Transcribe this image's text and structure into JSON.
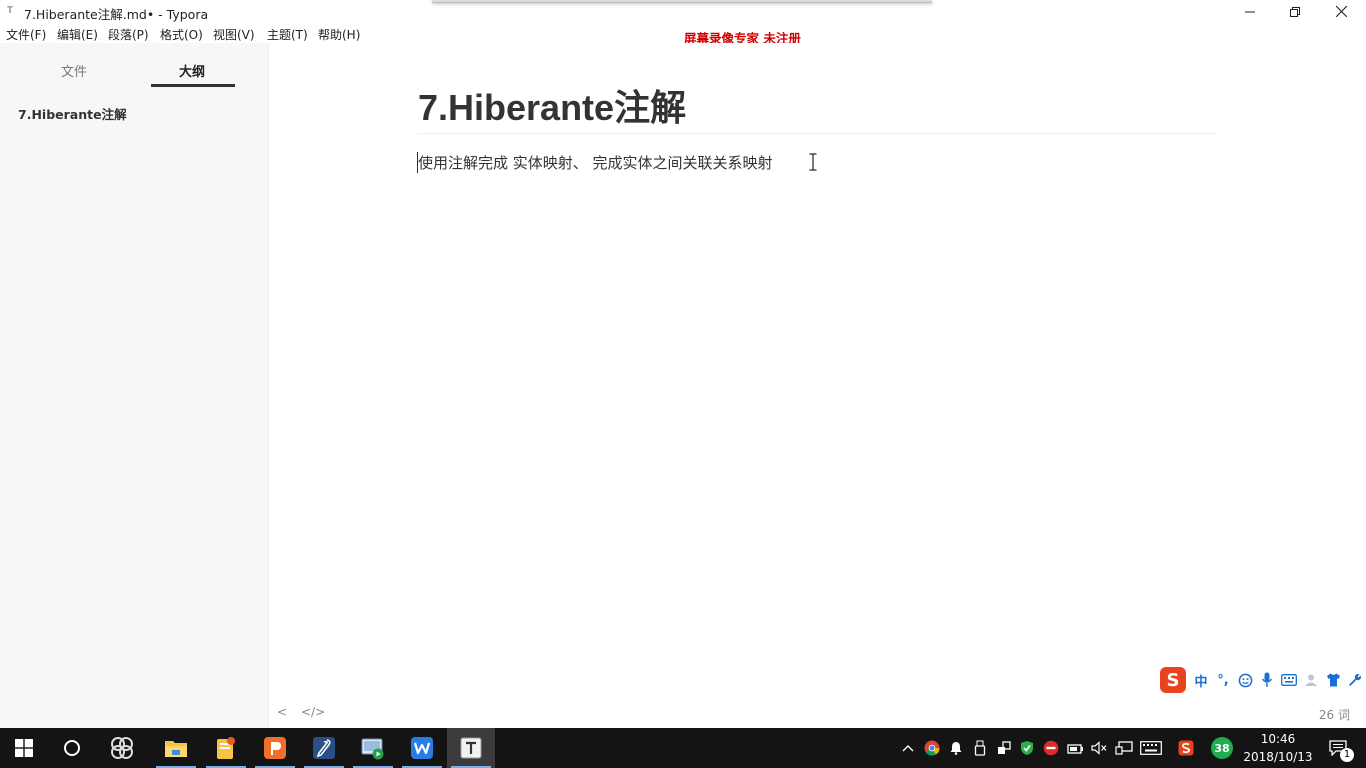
{
  "window": {
    "title": "7.Hiberante注解.md• - Typora",
    "app_icon": "T"
  },
  "menu": {
    "items": [
      "文件(F)",
      "编辑(E)",
      "段落(P)",
      "格式(O)",
      "视图(V)",
      "主题(T)",
      "帮助(H)"
    ]
  },
  "watermark": "屏幕录像专家  未注册",
  "sidebar": {
    "tabs": [
      "文件",
      "大纲"
    ],
    "active_tab": "大纲",
    "outline": [
      "7.Hiberante注解"
    ]
  },
  "document": {
    "heading": "7.Hiberante注解",
    "paragraph": "使用注解完成 实体映射、 完成实体之间关联关系映射"
  },
  "statusbar": {
    "back_glyph": "<",
    "source_glyph": "</>",
    "word_count": "26 词"
  },
  "ime": {
    "logo": "S",
    "mode": "中",
    "punct": "°,"
  },
  "taskbar": {
    "tray_badge": "38",
    "time": "10:46",
    "date": "2018/10/13",
    "notification_count": "1"
  },
  "colors": {
    "watermark": "#d40000",
    "taskbar": "#141414",
    "sidebar": "#f7f7f7",
    "ime_logo": "#e8431c",
    "tray_badge": "#1fae4f"
  }
}
